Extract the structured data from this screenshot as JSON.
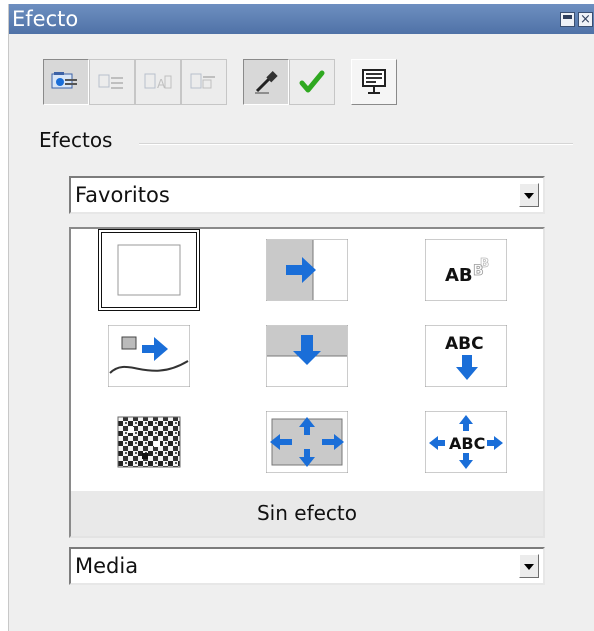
{
  "window": {
    "title": "Efecto"
  },
  "toolbar": {
    "buttons": [
      {
        "name": "effects-mode-icon",
        "state": "pressed"
      },
      {
        "name": "text-effects-icon",
        "state": "disabled"
      },
      {
        "name": "object-effects-icon",
        "state": "disabled"
      },
      {
        "name": "other-effects-icon",
        "state": "disabled"
      },
      {
        "name": "assign-pipette-icon",
        "state": "pressed"
      },
      {
        "name": "apply-check-icon",
        "state": "normal"
      },
      {
        "name": "preview-window-icon",
        "state": "raised"
      }
    ],
    "accent_check": "#2fa820"
  },
  "effects": {
    "section_label": "Efectos",
    "category_value": "Favoritos",
    "gallery_items": [
      "no-effect-icon",
      "fly-in-from-left-icon",
      "text-fade-icon",
      "move-along-curve-icon",
      "fly-in-from-top-icon",
      "text-fly-down-icon",
      "dissolve-icon",
      "zoom-out-arrows-icon",
      "text-stretch-arrows-icon"
    ],
    "selected_caption": "Sin efecto",
    "speed_value": "Media"
  },
  "colors": {
    "accent_blue": "#1a6ed8",
    "title_blue": "#5b7cb2"
  }
}
